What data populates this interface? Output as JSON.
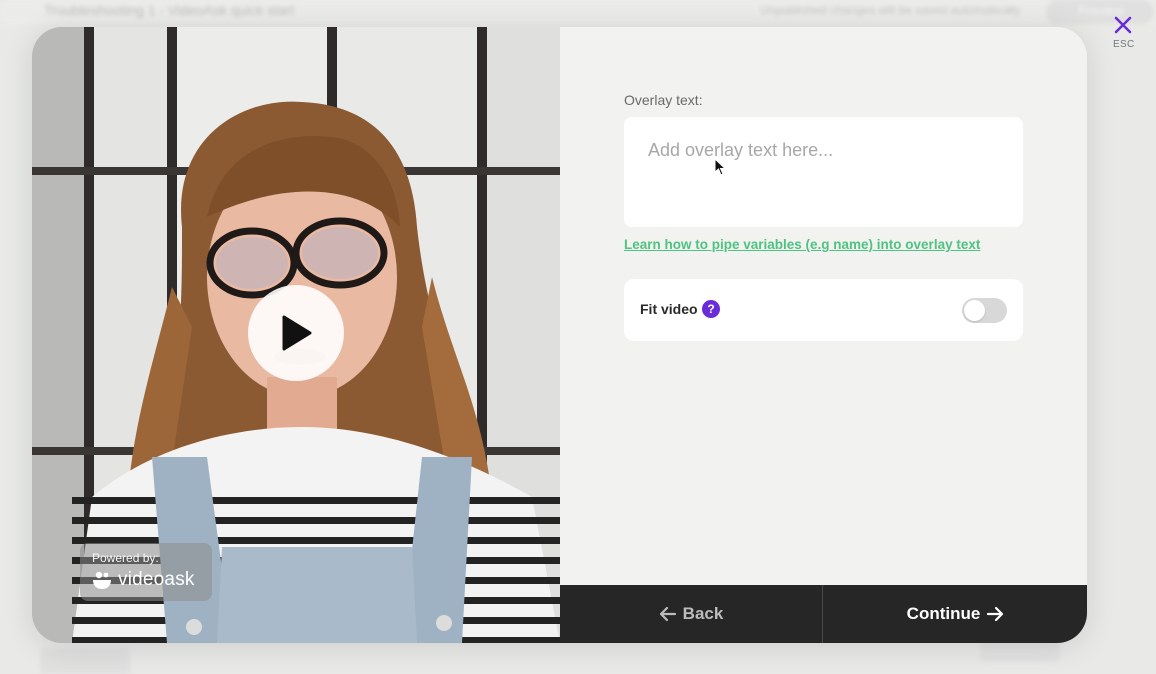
{
  "background": {
    "title": "Troubleshooting 1 - VideoAsk quick start",
    "right_text": "Unpublished changes will be saved automatically",
    "preview_label": "Preview"
  },
  "video": {
    "powered_by": "Powered by:",
    "brand": "videoask",
    "icons": {
      "play": "play-icon",
      "brand": "videoask-logo-icon"
    }
  },
  "form": {
    "overlay_label": "Overlay text:",
    "overlay_placeholder": "Add overlay text here...",
    "overlay_value": "",
    "pipe_link": "Learn how to pipe variables (e.g name) into overlay text",
    "fit_video_label": "Fit video",
    "fit_video_help": "?",
    "fit_video_enabled": false
  },
  "footer": {
    "back_label": "Back",
    "continue_label": "Continue"
  },
  "close": {
    "esc_label": "ESC"
  },
  "colors": {
    "accent_purple": "#6a2bd9",
    "link_green": "#4ec481",
    "footer_bg": "#262626"
  }
}
